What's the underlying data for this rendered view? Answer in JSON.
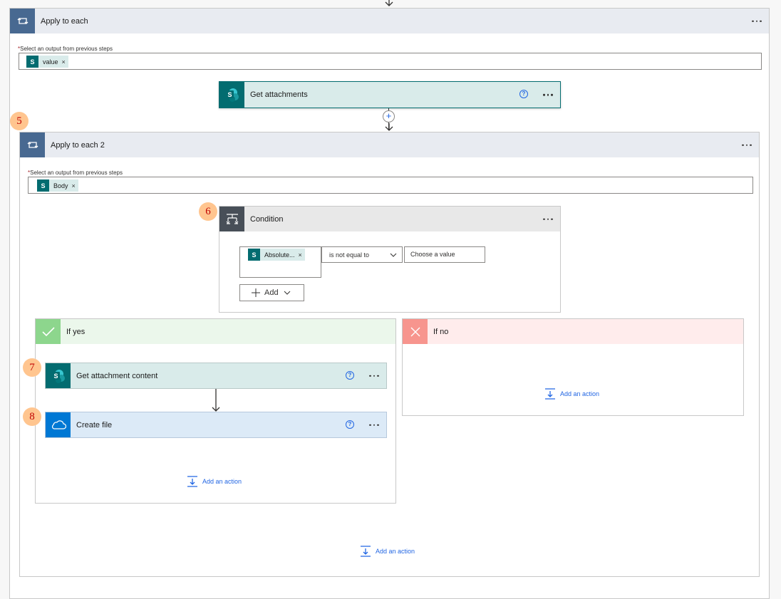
{
  "outer_loop": {
    "title": "Apply to each",
    "field_label": "Select an output from previous steps",
    "token": "value"
  },
  "get_attachments": {
    "title": "Get attachments"
  },
  "insert_step_symbol": "+",
  "inner_loop": {
    "badge": "5",
    "title": "Apply to each 2",
    "field_label": "Select an output from previous steps",
    "token": "Body"
  },
  "condition": {
    "badge": "6",
    "title": "Condition",
    "left_token": "Absolute...",
    "operator": "is not equal to",
    "value_placeholder": "Choose a value",
    "add_label": "Add"
  },
  "if_yes": {
    "title": "If yes",
    "action1": {
      "badge": "7",
      "title": "Get attachment content"
    },
    "action2": {
      "badge": "8",
      "title": "Create file"
    },
    "add_action": "Add an action"
  },
  "if_no": {
    "title": "If no",
    "add_action": "Add an action"
  },
  "inner_add_action": "Add an action",
  "required_marker": "*",
  "sharepoint_letter": "S",
  "remove_symbol": "×",
  "help_symbol": "?",
  "colors": {
    "loop_header": "#e8ebf1",
    "loop_icon": "#486991",
    "sharepoint": "#036c70",
    "sharepoint_header": "#d9ebea",
    "condition_header": "#e8e8e8",
    "condition_icon": "#484f58",
    "yes_header": "#ebf7eb",
    "yes_icon": "#8dd68d",
    "no_header": "#ffecec",
    "no_icon": "#f7958e",
    "onedrive": "#0078d4",
    "onedrive_header": "#dceaf7",
    "link": "#2266e3",
    "badge": "#ffc58f"
  }
}
